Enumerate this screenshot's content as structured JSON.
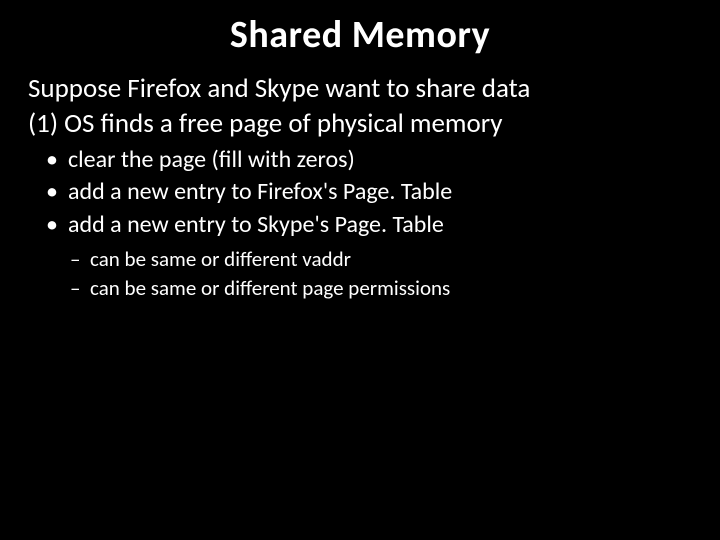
{
  "title": "Shared Memory",
  "lead": "Suppose Firefox and Skype want to share data",
  "step": "(1) OS finds a free page of physical memory",
  "bullets": [
    "clear the page (fill with zeros)",
    "add a new entry to Firefox's Page. Table",
    "add a new entry to Skype's Page. Table"
  ],
  "subs": [
    "can be same or different vaddr",
    "can be same or different page permissions"
  ]
}
